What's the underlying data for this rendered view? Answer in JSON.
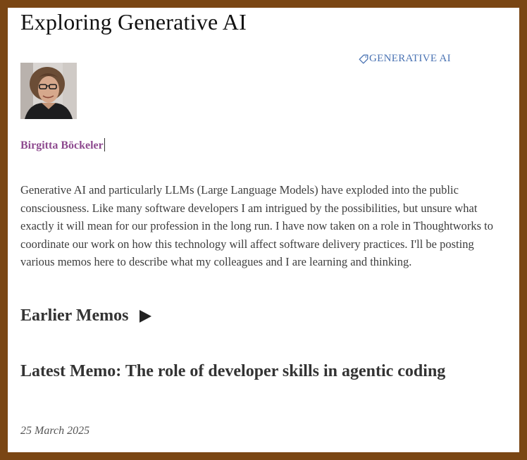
{
  "page": {
    "title": "Exploring Generative AI"
  },
  "tag": {
    "label": "GENERATIVE AI",
    "icon": "tag-icon"
  },
  "author": {
    "name": "Birgitta Böckeler",
    "photo": "author-photo"
  },
  "intro": {
    "text": "Generative AI and particularly LLMs (Large Language Models) have exploded into the public consciousness. Like many software developers I am intrigued by the possibilities, but unsure what exactly it will mean for our profession in the long run. I have now taken on a role in Thoughtworks to coordinate our work on how this technology will affect software delivery practices. I'll be posting various memos here to describe what my colleagues and I are learning and thinking."
  },
  "earlier_memos": {
    "label": "Earlier Memos",
    "icon": "triangle-right-icon",
    "expanded": false
  },
  "latest_memo": {
    "title": "Latest Memo: The role of developer skills in agentic coding",
    "date": "25 March 2025"
  },
  "colors": {
    "frame": "#7a4614",
    "tag_link": "#4a73b3",
    "author_link": "#8e4a8f",
    "heading_text": "#333333",
    "body_text": "#3d3d3d"
  }
}
